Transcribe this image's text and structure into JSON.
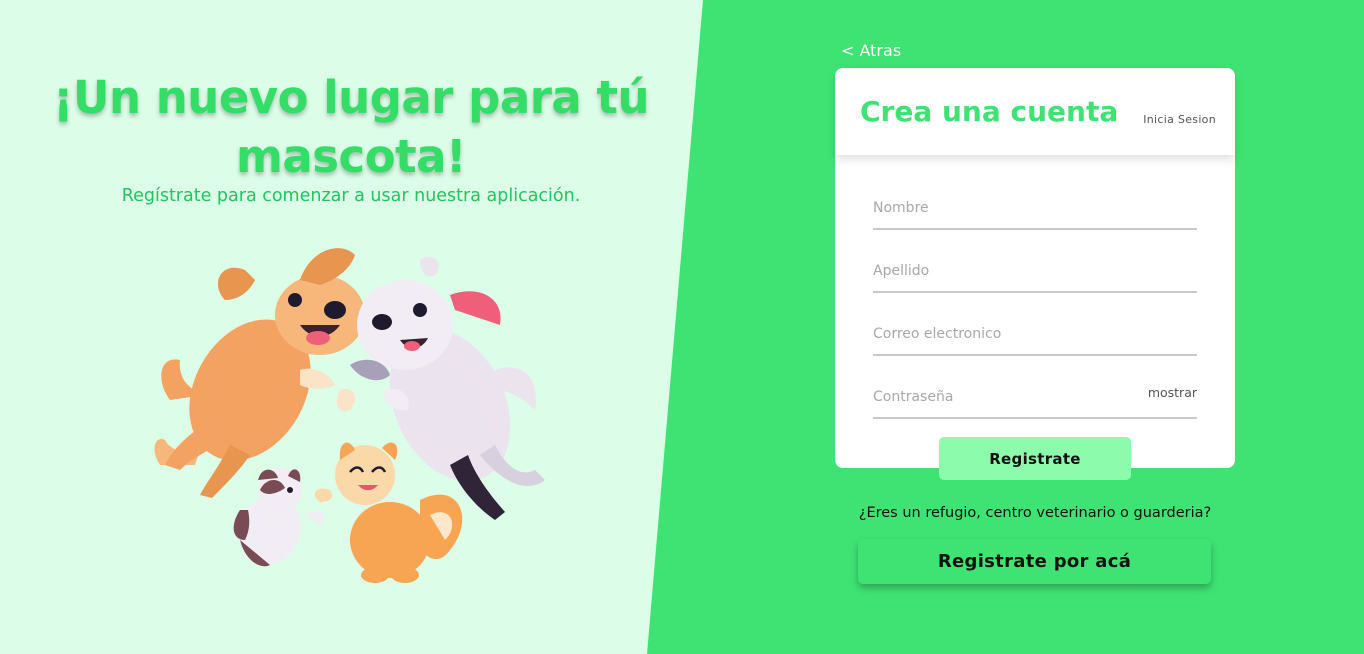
{
  "hero": {
    "title": "¡Un nuevo lugar para tú mascota!",
    "subtitle": "Regístrate para comenzar a usar nuestra aplicación."
  },
  "nav": {
    "back_label": "< Atras"
  },
  "card": {
    "title": "Crea una cuenta",
    "login_link": "Inicia Sesion",
    "fields": {
      "nombre": {
        "placeholder": "Nombre",
        "value": ""
      },
      "apellido": {
        "placeholder": "Apellido",
        "value": ""
      },
      "correo": {
        "placeholder": "Correo electronico",
        "value": ""
      },
      "password": {
        "placeholder": "Contraseña",
        "value": "",
        "toggle_label": "mostrar"
      }
    },
    "submit_label": "Registrate"
  },
  "partner": {
    "question": "¿Eres un refugio, centro veterinario o guarderia?",
    "button_label": "Registrate por acá"
  },
  "colors": {
    "brand_green": "#3fe374",
    "light_bg": "#dcfde8",
    "button_light": "#8dfbac"
  },
  "illustration": {
    "icon": "playing-pets-illustration"
  }
}
